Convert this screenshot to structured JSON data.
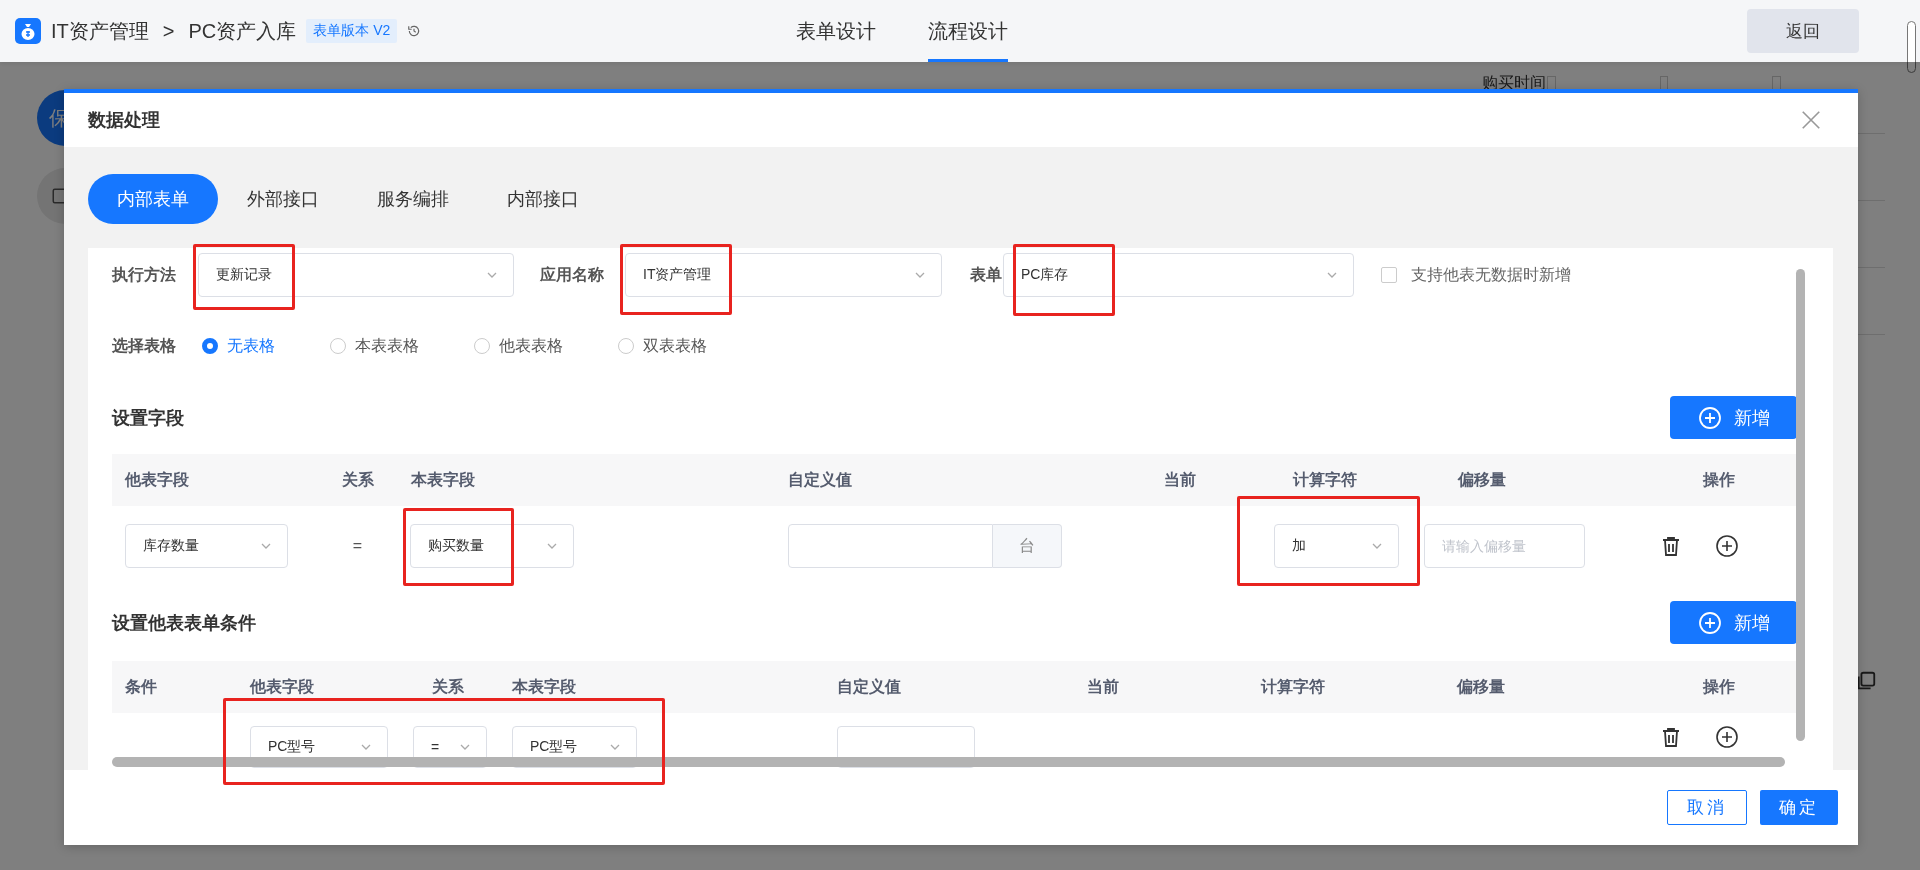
{
  "header": {
    "app_title": "IT资产管理",
    "separator": ">",
    "page_title": "PC资产入库",
    "version_badge": "表单版本 V2",
    "tabs": [
      {
        "label": "表单设计",
        "selected": false
      },
      {
        "label": "流程设计",
        "selected": true
      }
    ],
    "back_button": "返回"
  },
  "background": {
    "side_button": "保",
    "right_panel_label": "购买时间",
    "right_panel_checkboxes": [
      {
        "checked": false
      },
      {
        "checked": false
      },
      {
        "checked": false
      }
    ]
  },
  "dialog": {
    "title": "数据处理",
    "tabs": [
      {
        "label": "内部表单",
        "selected": true
      },
      {
        "label": "外部接口",
        "selected": false
      },
      {
        "label": "服务编排",
        "selected": false
      },
      {
        "label": "内部接口",
        "selected": false
      }
    ],
    "fields": [
      {
        "label": "执行方法",
        "value": "更新记录"
      },
      {
        "label": "应用名称",
        "value": "IT资产管理"
      },
      {
        "label": "表单",
        "value": "PC库存"
      }
    ],
    "checkbox": {
      "label": "支持他表无数据时新增",
      "checked": false
    },
    "table_select": {
      "label": "选择表格",
      "options": [
        {
          "label": "无表格",
          "selected": true
        },
        {
          "label": "本表表格",
          "selected": false
        },
        {
          "label": "他表表格",
          "selected": false
        },
        {
          "label": "双表表格",
          "selected": false
        }
      ]
    },
    "sections": [
      {
        "title": "设置字段",
        "add_button": "新增",
        "columns": [
          "他表字段",
          "关系",
          "本表字段",
          "自定义值",
          "当前",
          "计算字符",
          "偏移量",
          "操作"
        ],
        "rows": [
          [
            {
              "kind": "select",
              "value": "库存数量"
            },
            {
              "kind": "text",
              "text": "="
            },
            {
              "kind": "select",
              "value": "购买数量"
            },
            {
              "kind": "addon_input",
              "addon": "台"
            },
            {
              "kind": "empty"
            },
            {
              "kind": "select",
              "value": "加"
            },
            {
              "kind": "input",
              "placeholder": "请输入偏移量"
            },
            {
              "kind": "actions"
            }
          ]
        ]
      },
      {
        "title": "设置他表表单条件",
        "add_button": "新增",
        "columns": [
          "条件",
          "他表字段",
          "关系",
          "本表字段",
          "自定义值",
          "当前",
          "计算字符",
          "偏移量",
          "操作"
        ],
        "rows": [
          [
            {
              "kind": "empty"
            },
            {
              "kind": "select",
              "value": "PC型号"
            },
            {
              "kind": "select",
              "value": "="
            },
            {
              "kind": "select",
              "value": "PC型号"
            },
            {
              "kind": "input"
            },
            {
              "kind": "empty"
            },
            {
              "kind": "empty"
            },
            {
              "kind": "empty"
            },
            {
              "kind": "actions"
            }
          ]
        ]
      }
    ],
    "footer": {
      "cancel": "取消",
      "ok": "确定"
    }
  }
}
